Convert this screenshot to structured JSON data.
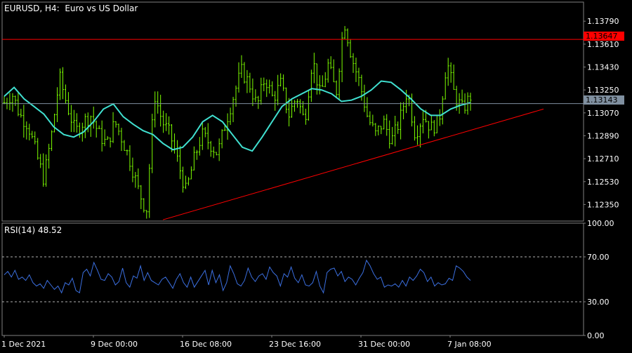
{
  "header": {
    "symbol": "EURUSD",
    "timeframe": "H4",
    "description": "Euro vs US Dollar"
  },
  "rsi_panel": {
    "label": "RSI(14) 48.52"
  },
  "price_axis": {
    "ticks": [
      "1.13790",
      "1.13610",
      "1.13430",
      "1.13250",
      "1.13070",
      "1.12890",
      "1.12710",
      "1.12530",
      "1.12350"
    ]
  },
  "rsi_axis": {
    "ticks": [
      "100.00",
      "70.00",
      "30.00",
      "0.00"
    ]
  },
  "time_axis": {
    "ticks": [
      "1 Dec 2021",
      "9 Dec 00:00",
      "16 Dec 08:00",
      "23 Dec 16:00",
      "31 Dec 00:00",
      "7 Jan 08:00"
    ]
  },
  "price_labels": {
    "resistance": "1.13647",
    "current": "1.13143"
  },
  "colors": {
    "background": "#000000",
    "bars": "#7cfc00",
    "moving_average": "#40e0d0",
    "resistance_line": "#ff0000",
    "trend_line": "#ff0000",
    "current_price_line": "#8090a0",
    "rsi_line": "#3b6fe0",
    "grid": "#808080"
  },
  "chart_data": [
    {
      "type": "ohlc",
      "title": "EURUSD, H4:  Euro vs US Dollar",
      "xlabel": "",
      "ylabel": "",
      "ylim": [
        1.1222,
        1.1394
      ],
      "x": [
        "1 Dec 2021",
        "9 Dec 00:00",
        "16 Dec 08:00",
        "23 Dec 16:00",
        "31 Dec 00:00",
        "7 Jan 08:00"
      ],
      "series": [
        {
          "kind": "close_sample",
          "values": [
            1.1315,
            1.1322,
            1.1305,
            1.1298,
            1.1276,
            1.1255,
            1.129,
            1.1335,
            1.1312,
            1.1292,
            1.13,
            1.1305,
            1.129,
            1.1282,
            1.13,
            1.1285,
            1.1268,
            1.1246,
            1.123,
            1.1322,
            1.13,
            1.129,
            1.1268,
            1.1245,
            1.127,
            1.129,
            1.1283,
            1.1275,
            1.1299,
            1.132,
            1.134,
            1.133,
            1.1312,
            1.1335,
            1.1318,
            1.133,
            1.1305,
            1.132,
            1.13,
            1.135,
            1.132,
            1.1345,
            1.1322,
            1.138,
            1.135,
            1.133,
            1.1303,
            1.129,
            1.13,
            1.1285,
            1.13,
            1.1325,
            1.129,
            1.1305,
            1.1295,
            1.13,
            1.1348,
            1.132,
            1.131,
            1.132
          ]
        },
        {
          "kind": "moving_average",
          "values": [
            1.132,
            1.1327,
            1.1318,
            1.1312,
            1.1306,
            1.1296,
            1.129,
            1.1288,
            1.1292,
            1.13,
            1.131,
            1.1314,
            1.1304,
            1.1298,
            1.1293,
            1.129,
            1.1283,
            1.1278,
            1.128,
            1.1288,
            1.13,
            1.1305,
            1.13,
            1.129,
            1.128,
            1.1277,
            1.1288,
            1.13,
            1.1312,
            1.1318,
            1.1322,
            1.1326,
            1.1325,
            1.1322,
            1.1316,
            1.1317,
            1.132,
            1.1325,
            1.1332,
            1.1331,
            1.1325,
            1.1318,
            1.131,
            1.1305,
            1.1305,
            1.131,
            1.1313,
            1.1315
          ]
        }
      ],
      "annotations": [
        {
          "kind": "horizontal_line",
          "name": "resistance",
          "y": 1.13647
        },
        {
          "kind": "horizontal_line",
          "name": "current_price",
          "y": 1.13143
        },
        {
          "kind": "trend_line",
          "x0": "13 Dec",
          "y0": 1.1223,
          "x1": "10 Jan",
          "y1": 1.131
        }
      ]
    },
    {
      "type": "line",
      "title": "RSI(14) 48.52",
      "xlabel": "",
      "ylabel": "",
      "ylim": [
        0,
        100
      ],
      "levels": [
        70,
        30
      ],
      "series": [
        {
          "name": "RSI(14)",
          "values": [
            54,
            57,
            52,
            58,
            50,
            52,
            49,
            54,
            47,
            44,
            46,
            42,
            49,
            45,
            41,
            44,
            38,
            47,
            45,
            51,
            40,
            38,
            56,
            59,
            53,
            65,
            58,
            50,
            49,
            55,
            52,
            45,
            48,
            60,
            47,
            43,
            53,
            51,
            62,
            49,
            56,
            49,
            47,
            45,
            50,
            52,
            47,
            42,
            50,
            55,
            47,
            43,
            52,
            43,
            48,
            53,
            58,
            45,
            58,
            47,
            54,
            40,
            47,
            62,
            55,
            46,
            44,
            49,
            60,
            52,
            48,
            53,
            55,
            50,
            61,
            56,
            53,
            44,
            55,
            52,
            61,
            51,
            47,
            54,
            45,
            44,
            47,
            57,
            44,
            38,
            56,
            59,
            60,
            53,
            57,
            48,
            52,
            50,
            45,
            51,
            56,
            67,
            62,
            55,
            50,
            52,
            43,
            45,
            44,
            46,
            43,
            49,
            44,
            52,
            49,
            53,
            59,
            56,
            48,
            52,
            44,
            47,
            45,
            46,
            51,
            49,
            62,
            60,
            57,
            52,
            49
          ]
        }
      ]
    }
  ]
}
